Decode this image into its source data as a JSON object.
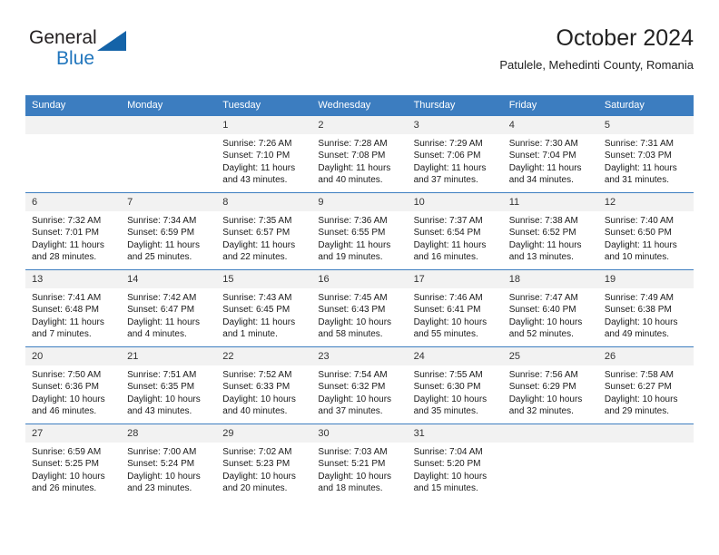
{
  "brand": {
    "name_top": "General",
    "name_bottom": "Blue",
    "triangle_color": "#1463a8",
    "blue_text_color": "#2176bd"
  },
  "header": {
    "title": "October 2024",
    "subtitle": "Patulele, Mehedinti County, Romania"
  },
  "theme": {
    "header_blue": "#3c7dc0",
    "daynum_band": "#f2f2f2",
    "text": "#1a1a1a"
  },
  "weekday_headers": [
    "Sunday",
    "Monday",
    "Tuesday",
    "Wednesday",
    "Thursday",
    "Friday",
    "Saturday"
  ],
  "weeks": [
    [
      {
        "day": "",
        "sunrise": "",
        "sunset": "",
        "daylight_line1": "",
        "daylight_line2": ""
      },
      {
        "day": "",
        "sunrise": "",
        "sunset": "",
        "daylight_line1": "",
        "daylight_line2": ""
      },
      {
        "day": "1",
        "sunrise": "Sunrise: 7:26 AM",
        "sunset": "Sunset: 7:10 PM",
        "daylight_line1": "Daylight: 11 hours",
        "daylight_line2": "and 43 minutes."
      },
      {
        "day": "2",
        "sunrise": "Sunrise: 7:28 AM",
        "sunset": "Sunset: 7:08 PM",
        "daylight_line1": "Daylight: 11 hours",
        "daylight_line2": "and 40 minutes."
      },
      {
        "day": "3",
        "sunrise": "Sunrise: 7:29 AM",
        "sunset": "Sunset: 7:06 PM",
        "daylight_line1": "Daylight: 11 hours",
        "daylight_line2": "and 37 minutes."
      },
      {
        "day": "4",
        "sunrise": "Sunrise: 7:30 AM",
        "sunset": "Sunset: 7:04 PM",
        "daylight_line1": "Daylight: 11 hours",
        "daylight_line2": "and 34 minutes."
      },
      {
        "day": "5",
        "sunrise": "Sunrise: 7:31 AM",
        "sunset": "Sunset: 7:03 PM",
        "daylight_line1": "Daylight: 11 hours",
        "daylight_line2": "and 31 minutes."
      }
    ],
    [
      {
        "day": "6",
        "sunrise": "Sunrise: 7:32 AM",
        "sunset": "Sunset: 7:01 PM",
        "daylight_line1": "Daylight: 11 hours",
        "daylight_line2": "and 28 minutes."
      },
      {
        "day": "7",
        "sunrise": "Sunrise: 7:34 AM",
        "sunset": "Sunset: 6:59 PM",
        "daylight_line1": "Daylight: 11 hours",
        "daylight_line2": "and 25 minutes."
      },
      {
        "day": "8",
        "sunrise": "Sunrise: 7:35 AM",
        "sunset": "Sunset: 6:57 PM",
        "daylight_line1": "Daylight: 11 hours",
        "daylight_line2": "and 22 minutes."
      },
      {
        "day": "9",
        "sunrise": "Sunrise: 7:36 AM",
        "sunset": "Sunset: 6:55 PM",
        "daylight_line1": "Daylight: 11 hours",
        "daylight_line2": "and 19 minutes."
      },
      {
        "day": "10",
        "sunrise": "Sunrise: 7:37 AM",
        "sunset": "Sunset: 6:54 PM",
        "daylight_line1": "Daylight: 11 hours",
        "daylight_line2": "and 16 minutes."
      },
      {
        "day": "11",
        "sunrise": "Sunrise: 7:38 AM",
        "sunset": "Sunset: 6:52 PM",
        "daylight_line1": "Daylight: 11 hours",
        "daylight_line2": "and 13 minutes."
      },
      {
        "day": "12",
        "sunrise": "Sunrise: 7:40 AM",
        "sunset": "Sunset: 6:50 PM",
        "daylight_line1": "Daylight: 11 hours",
        "daylight_line2": "and 10 minutes."
      }
    ],
    [
      {
        "day": "13",
        "sunrise": "Sunrise: 7:41 AM",
        "sunset": "Sunset: 6:48 PM",
        "daylight_line1": "Daylight: 11 hours",
        "daylight_line2": "and 7 minutes."
      },
      {
        "day": "14",
        "sunrise": "Sunrise: 7:42 AM",
        "sunset": "Sunset: 6:47 PM",
        "daylight_line1": "Daylight: 11 hours",
        "daylight_line2": "and 4 minutes."
      },
      {
        "day": "15",
        "sunrise": "Sunrise: 7:43 AM",
        "sunset": "Sunset: 6:45 PM",
        "daylight_line1": "Daylight: 11 hours",
        "daylight_line2": "and 1 minute."
      },
      {
        "day": "16",
        "sunrise": "Sunrise: 7:45 AM",
        "sunset": "Sunset: 6:43 PM",
        "daylight_line1": "Daylight: 10 hours",
        "daylight_line2": "and 58 minutes."
      },
      {
        "day": "17",
        "sunrise": "Sunrise: 7:46 AM",
        "sunset": "Sunset: 6:41 PM",
        "daylight_line1": "Daylight: 10 hours",
        "daylight_line2": "and 55 minutes."
      },
      {
        "day": "18",
        "sunrise": "Sunrise: 7:47 AM",
        "sunset": "Sunset: 6:40 PM",
        "daylight_line1": "Daylight: 10 hours",
        "daylight_line2": "and 52 minutes."
      },
      {
        "day": "19",
        "sunrise": "Sunrise: 7:49 AM",
        "sunset": "Sunset: 6:38 PM",
        "daylight_line1": "Daylight: 10 hours",
        "daylight_line2": "and 49 minutes."
      }
    ],
    [
      {
        "day": "20",
        "sunrise": "Sunrise: 7:50 AM",
        "sunset": "Sunset: 6:36 PM",
        "daylight_line1": "Daylight: 10 hours",
        "daylight_line2": "and 46 minutes."
      },
      {
        "day": "21",
        "sunrise": "Sunrise: 7:51 AM",
        "sunset": "Sunset: 6:35 PM",
        "daylight_line1": "Daylight: 10 hours",
        "daylight_line2": "and 43 minutes."
      },
      {
        "day": "22",
        "sunrise": "Sunrise: 7:52 AM",
        "sunset": "Sunset: 6:33 PM",
        "daylight_line1": "Daylight: 10 hours",
        "daylight_line2": "and 40 minutes."
      },
      {
        "day": "23",
        "sunrise": "Sunrise: 7:54 AM",
        "sunset": "Sunset: 6:32 PM",
        "daylight_line1": "Daylight: 10 hours",
        "daylight_line2": "and 37 minutes."
      },
      {
        "day": "24",
        "sunrise": "Sunrise: 7:55 AM",
        "sunset": "Sunset: 6:30 PM",
        "daylight_line1": "Daylight: 10 hours",
        "daylight_line2": "and 35 minutes."
      },
      {
        "day": "25",
        "sunrise": "Sunrise: 7:56 AM",
        "sunset": "Sunset: 6:29 PM",
        "daylight_line1": "Daylight: 10 hours",
        "daylight_line2": "and 32 minutes."
      },
      {
        "day": "26",
        "sunrise": "Sunrise: 7:58 AM",
        "sunset": "Sunset: 6:27 PM",
        "daylight_line1": "Daylight: 10 hours",
        "daylight_line2": "and 29 minutes."
      }
    ],
    [
      {
        "day": "27",
        "sunrise": "Sunrise: 6:59 AM",
        "sunset": "Sunset: 5:25 PM",
        "daylight_line1": "Daylight: 10 hours",
        "daylight_line2": "and 26 minutes."
      },
      {
        "day": "28",
        "sunrise": "Sunrise: 7:00 AM",
        "sunset": "Sunset: 5:24 PM",
        "daylight_line1": "Daylight: 10 hours",
        "daylight_line2": "and 23 minutes."
      },
      {
        "day": "29",
        "sunrise": "Sunrise: 7:02 AM",
        "sunset": "Sunset: 5:23 PM",
        "daylight_line1": "Daylight: 10 hours",
        "daylight_line2": "and 20 minutes."
      },
      {
        "day": "30",
        "sunrise": "Sunrise: 7:03 AM",
        "sunset": "Sunset: 5:21 PM",
        "daylight_line1": "Daylight: 10 hours",
        "daylight_line2": "and 18 minutes."
      },
      {
        "day": "31",
        "sunrise": "Sunrise: 7:04 AM",
        "sunset": "Sunset: 5:20 PM",
        "daylight_line1": "Daylight: 10 hours",
        "daylight_line2": "and 15 minutes."
      },
      {
        "day": "",
        "sunrise": "",
        "sunset": "",
        "daylight_line1": "",
        "daylight_line2": ""
      },
      {
        "day": "",
        "sunrise": "",
        "sunset": "",
        "daylight_line1": "",
        "daylight_line2": ""
      }
    ]
  ]
}
